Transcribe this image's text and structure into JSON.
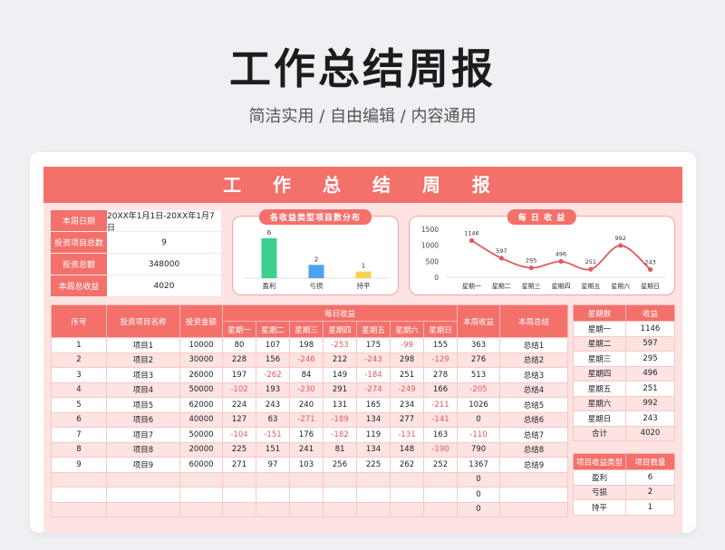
{
  "page": {
    "title": "工作总结周报",
    "subtitle": "简洁实用 / 自由编辑 / 内容通用"
  },
  "sheet": {
    "banner": "工 作 总 结 周 报",
    "info": [
      {
        "label": "本周日期",
        "value": "20XX年1月1日-20XX年1月7日"
      },
      {
        "label": "投资项目总数",
        "value": "9"
      },
      {
        "label": "投资总额",
        "value": "348000"
      },
      {
        "label": "本周总收益",
        "value": "4020"
      }
    ],
    "bar_panel_title": "各收益类型项目数分布",
    "line_panel_title": "每 日 收 益"
  },
  "chart_data": [
    {
      "type": "bar",
      "categories": [
        "盈利",
        "亏损",
        "持平"
      ],
      "values": [
        6,
        2,
        1
      ],
      "colors": [
        "#3ccf8e",
        "#4aa3f0",
        "#f7d154"
      ],
      "ylim": [
        0,
        6
      ]
    },
    {
      "type": "line",
      "categories": [
        "星期一",
        "星期二",
        "星期三",
        "星期四",
        "星期五",
        "星期六",
        "星期日"
      ],
      "values": [
        1146,
        597,
        295,
        496,
        251,
        992,
        243
      ],
      "yticks": [
        0,
        500,
        1000,
        1500
      ],
      "ylim": [
        0,
        1500
      ],
      "color": "#e25a5a"
    }
  ],
  "main_table": {
    "headers": {
      "index": "序号",
      "name": "投资项目名称",
      "amount": "投资金额",
      "daily": "每日收益",
      "days": [
        "星期一",
        "星期二",
        "星期三",
        "星期四",
        "星期五",
        "星期六",
        "星期日"
      ],
      "week_income": "本周收益",
      "summary": "本周总结"
    },
    "rows": [
      {
        "idx": "1",
        "name": "项目1",
        "amount": "10000",
        "d": [
          "80",
          "107",
          "198",
          "-253",
          "175",
          "-99",
          "155"
        ],
        "week": "363",
        "sum": "总结1"
      },
      {
        "idx": "2",
        "name": "项目2",
        "amount": "30000",
        "d": [
          "228",
          "156",
          "-246",
          "212",
          "-243",
          "298",
          "-129"
        ],
        "week": "276",
        "sum": "总结2"
      },
      {
        "idx": "3",
        "name": "项目3",
        "amount": "26000",
        "d": [
          "197",
          "-262",
          "84",
          "149",
          "-184",
          "251",
          "278"
        ],
        "week": "513",
        "sum": "总结3"
      },
      {
        "idx": "4",
        "name": "项目4",
        "amount": "50000",
        "d": [
          "-102",
          "193",
          "-230",
          "291",
          "-274",
          "-249",
          "166"
        ],
        "week": "-205",
        "sum": "总结4"
      },
      {
        "idx": "5",
        "name": "项目5",
        "amount": "62000",
        "d": [
          "224",
          "243",
          "240",
          "131",
          "165",
          "234",
          "-211"
        ],
        "week": "1026",
        "sum": "总结5"
      },
      {
        "idx": "6",
        "name": "项目6",
        "amount": "40000",
        "d": [
          "127",
          "63",
          "-271",
          "-189",
          "134",
          "277",
          "-141"
        ],
        "week": "0",
        "sum": "总结6"
      },
      {
        "idx": "7",
        "name": "项目7",
        "amount": "50000",
        "d": [
          "-104",
          "-151",
          "176",
          "-182",
          "119",
          "-131",
          "163"
        ],
        "week": "-110",
        "sum": "总结7"
      },
      {
        "idx": "8",
        "name": "项目8",
        "amount": "20000",
        "d": [
          "225",
          "151",
          "241",
          "81",
          "134",
          "148",
          "-190"
        ],
        "week": "790",
        "sum": "总结8"
      },
      {
        "idx": "9",
        "name": "项目9",
        "amount": "60000",
        "d": [
          "271",
          "97",
          "103",
          "256",
          "225",
          "262",
          "252"
        ],
        "week": "1367",
        "sum": "总结9"
      },
      {
        "idx": "",
        "name": "",
        "amount": "",
        "d": [
          "",
          "",
          "",
          "",
          "",
          "",
          ""
        ],
        "week": "0",
        "sum": ""
      },
      {
        "idx": "",
        "name": "",
        "amount": "",
        "d": [
          "",
          "",
          "",
          "",
          "",
          "",
          ""
        ],
        "week": "0",
        "sum": ""
      },
      {
        "idx": "",
        "name": "",
        "amount": "",
        "d": [
          "",
          "",
          "",
          "",
          "",
          "",
          ""
        ],
        "week": "0",
        "sum": ""
      }
    ]
  },
  "weekday_table": {
    "headers": [
      "星期数",
      "收益"
    ],
    "rows": [
      [
        "星期一",
        "1146"
      ],
      [
        "星期二",
        "597"
      ],
      [
        "星期三",
        "295"
      ],
      [
        "星期四",
        "496"
      ],
      [
        "星期五",
        "251"
      ],
      [
        "星期六",
        "992"
      ],
      [
        "星期日",
        "243"
      ],
      [
        "合计",
        "4020"
      ]
    ]
  },
  "type_table": {
    "headers": [
      "项目收益类型",
      "项目数量"
    ],
    "rows": [
      [
        "盈利",
        "6"
      ],
      [
        "亏损",
        "2"
      ],
      [
        "持平",
        "1"
      ]
    ]
  }
}
